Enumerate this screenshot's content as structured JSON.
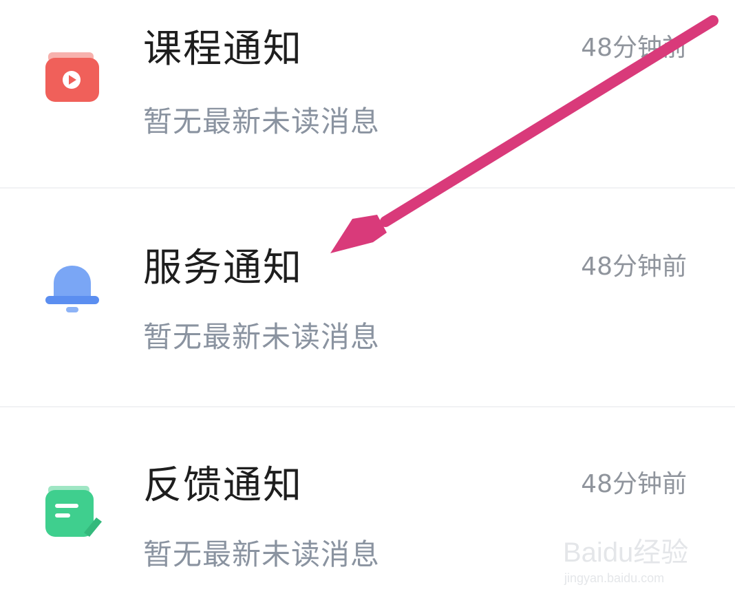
{
  "notifications": [
    {
      "title": "课程通知",
      "subtitle": "暂无最新未读消息",
      "time": "48分钟前",
      "icon": "video-play-icon",
      "color": "#f0605a"
    },
    {
      "title": "服务通知",
      "subtitle": "暂无最新未读消息",
      "time": "48分钟前",
      "icon": "bell-icon",
      "color": "#5b8ef0"
    },
    {
      "title": "反馈通知",
      "subtitle": "暂无最新未读消息",
      "time": "48分钟前",
      "icon": "feedback-note-icon",
      "color": "#3fcf8e"
    }
  ],
  "annotation": {
    "arrow_color": "#d93a7a"
  },
  "watermark": {
    "brand": "Baidu经验",
    "url": "jingyan.baidu.com"
  }
}
